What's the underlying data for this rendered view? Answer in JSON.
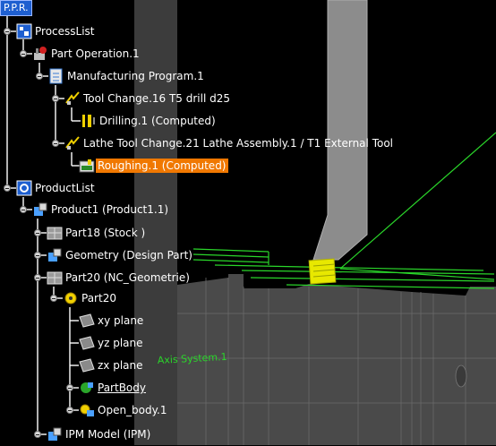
{
  "title": "P.P.R.",
  "tree": [
    {
      "id": "processlist",
      "label": "ProcessList",
      "icon": "process-list-icon",
      "expanded": true
    },
    {
      "id": "part-operation",
      "label": "Part Operation.1",
      "icon": "part-operation-icon",
      "expanded": true
    },
    {
      "id": "manufacturing-program",
      "label": "Manufacturing Program.1",
      "icon": "manufacturing-program-icon",
      "expanded": true
    },
    {
      "id": "tool-change-16",
      "label": "Tool Change.16  T5 drill d25",
      "icon": "tool-change-icon",
      "expanded": true
    },
    {
      "id": "drilling",
      "label": "Drilling.1 (Computed)",
      "icon": "drilling-icon",
      "expanded": false
    },
    {
      "id": "lathe-tool-change-21",
      "label": "Lathe Tool Change.21  Lathe Assembly.1 / T1 External Tool",
      "icon": "tool-change-icon",
      "expanded": true
    },
    {
      "id": "roughing",
      "label": "Roughing.1 (Computed)",
      "icon": "roughing-icon",
      "expanded": false,
      "selected": true
    },
    {
      "id": "productlist",
      "label": "ProductList",
      "icon": "product-list-icon",
      "expanded": true
    },
    {
      "id": "product1",
      "label": "Product1 (Product1.1)",
      "icon": "product-icon",
      "expanded": true
    },
    {
      "id": "part18",
      "label": "Part18 (Stock )",
      "icon": "part-icon",
      "expanded": true
    },
    {
      "id": "geometry",
      "label": "Geometry (Design Part)",
      "icon": "product-icon",
      "expanded": true
    },
    {
      "id": "part20-nc",
      "label": "Part20 (NC_Geometrie)",
      "icon": "part-icon",
      "expanded": true
    },
    {
      "id": "part20",
      "label": "Part20",
      "icon": "part-gear-icon",
      "expanded": true
    },
    {
      "id": "xy-plane",
      "label": "xy plane",
      "icon": "plane-icon",
      "expanded": false
    },
    {
      "id": "yz-plane",
      "label": "yz plane",
      "icon": "plane-icon",
      "expanded": false
    },
    {
      "id": "zx-plane",
      "label": "zx plane",
      "icon": "plane-icon",
      "expanded": false
    },
    {
      "id": "partbody",
      "label": "PartBody",
      "icon": "partbody-icon",
      "expanded": true,
      "underline": true
    },
    {
      "id": "open-body",
      "label": "Open_body.1",
      "icon": "open-body-icon",
      "expanded": true
    },
    {
      "id": "ipm-model",
      "label": "IPM Model (IPM)",
      "icon": "product-icon",
      "expanded": true
    }
  ],
  "viewport": {
    "axis_label": "Axis System.1"
  },
  "colors": {
    "selection": "#f07800",
    "stock": "#4a4a4a",
    "tool": "#8c8c8c",
    "toolpath": "#2ad62a",
    "tree_line": "#ffffff",
    "header": "#1e5fd0"
  }
}
